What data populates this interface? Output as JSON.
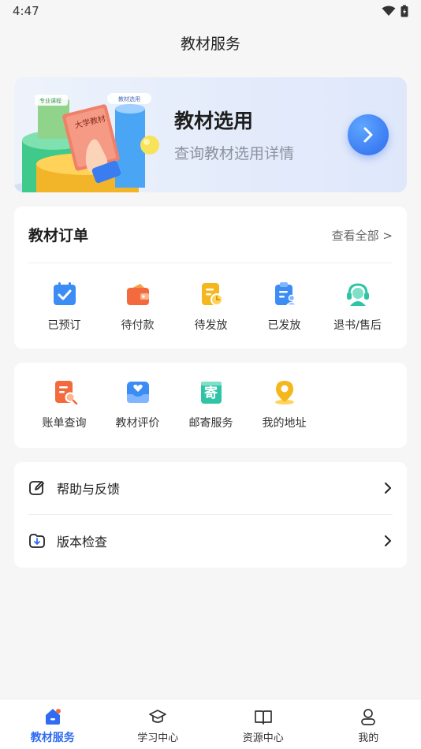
{
  "status": {
    "time": "4:47"
  },
  "header": {
    "title": "教材服务"
  },
  "banner": {
    "title": "教材选用",
    "subtitle": "查询教材选用详情",
    "book_text": "大学教材",
    "tag_left": "专业课程",
    "tag_right": "教材选用"
  },
  "orders": {
    "title": "教材订单",
    "view_all": "查看全部 >",
    "items": [
      {
        "label": "已预订",
        "icon": "calendar-check-icon"
      },
      {
        "label": "待付款",
        "icon": "wallet-icon"
      },
      {
        "label": "待发放",
        "icon": "clock-document-icon"
      },
      {
        "label": "已发放",
        "icon": "clipboard-user-icon"
      },
      {
        "label": "退书/售后",
        "icon": "headset-icon"
      }
    ]
  },
  "services": {
    "items": [
      {
        "label": "账单查询",
        "icon": "bill-search-icon"
      },
      {
        "label": "教材评价",
        "icon": "heart-tray-icon"
      },
      {
        "label": "邮寄服务",
        "icon": "mail-box-icon",
        "glyph": "寄"
      },
      {
        "label": "我的地址",
        "icon": "location-pin-icon"
      }
    ]
  },
  "settings": {
    "items": [
      {
        "label": "帮助与反馈",
        "icon": "edit-icon"
      },
      {
        "label": "版本检查",
        "icon": "download-icon"
      }
    ]
  },
  "tabs": [
    {
      "label": "教材服务",
      "icon": "home-icon",
      "active": true
    },
    {
      "label": "学习中心",
      "icon": "graduation-cap-icon",
      "active": false
    },
    {
      "label": "资源中心",
      "icon": "book-open-icon",
      "active": false
    },
    {
      "label": "我的",
      "icon": "user-icon",
      "active": false
    }
  ],
  "colors": {
    "accent": "#2f6cf1",
    "orange": "#f26a3d",
    "yellow": "#f5b71e",
    "blue": "#3c8cf5",
    "teal": "#2fc4a5"
  }
}
